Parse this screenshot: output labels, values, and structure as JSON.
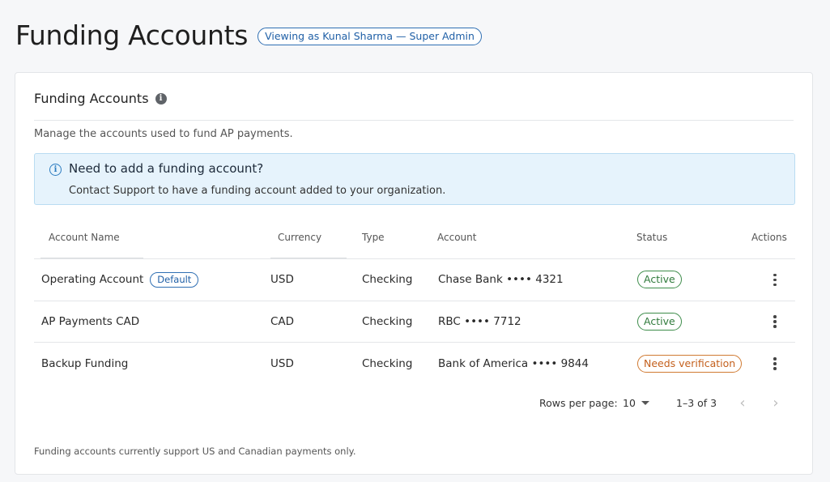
{
  "header": {
    "title": "Funding Accounts",
    "viewing_badge": "Viewing as Kunal Sharma — Super Admin"
  },
  "card": {
    "title": "Funding Accounts",
    "info_icon": "info-icon",
    "description": "Manage the accounts used to fund AP payments.",
    "alert": {
      "icon": "info-circle-icon",
      "title": "Need to add a funding account?",
      "body": "Contact Support to have a funding account added to your organization."
    },
    "table": {
      "columns": [
        "Account Name",
        "Currency",
        "Type",
        "Account",
        "Status",
        "Actions"
      ],
      "rows": [
        {
          "name": "Operating Account",
          "badge": "Default",
          "currency": "USD",
          "type": "Checking",
          "account": "Chase Bank •••• 4321",
          "status": "Active",
          "status_kind": "active"
        },
        {
          "name": "AP Payments CAD",
          "badge": "",
          "currency": "CAD",
          "type": "Checking",
          "account": "RBC •••• 7712",
          "status": "Active",
          "status_kind": "active"
        },
        {
          "name": "Backup Funding",
          "badge": "",
          "currency": "USD",
          "type": "Checking",
          "account": "Bank of America •••• 9844",
          "status": "Needs verification",
          "status_kind": "warning"
        }
      ]
    },
    "pagination": {
      "rows_per_page_label": "Rows per page:",
      "rows_per_page_value": "10",
      "range": "1–3 of 3"
    },
    "footnote": "Funding accounts currently support US and Canadian payments only."
  },
  "colors": {
    "accent": "#1f5fa6",
    "active": "#2f7a3b",
    "warning": "#c4601d",
    "alert_bg": "#e6f3fc"
  }
}
